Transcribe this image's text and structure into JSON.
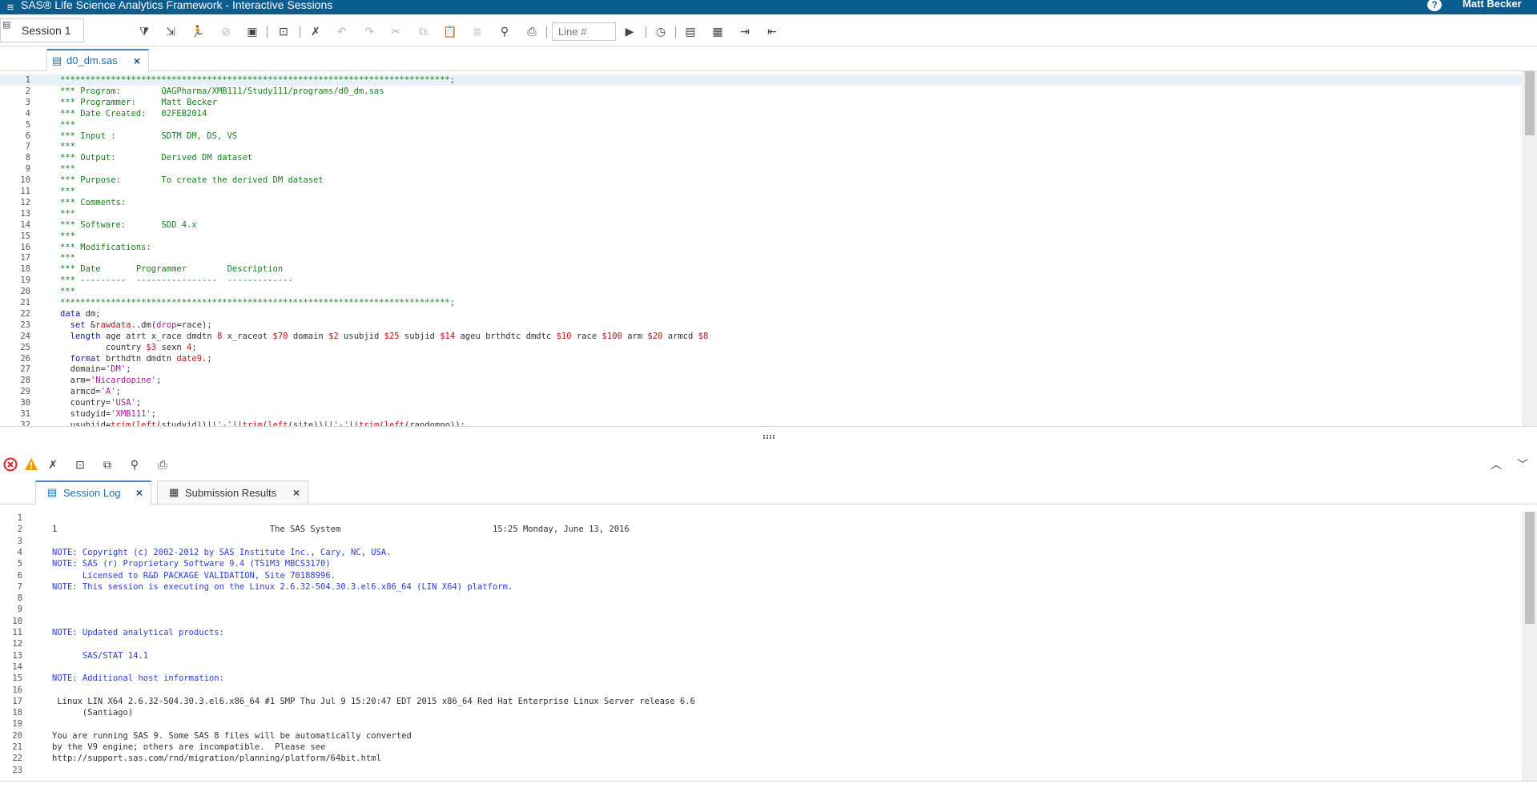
{
  "app": {
    "title": "SAS® Life Science Analytics Framework - Interactive Sessions",
    "user": "Matt Becker",
    "help_label": "?"
  },
  "toolbar": {
    "session_label": "Session 1",
    "line_placeholder": "Line #"
  },
  "editor_tab": {
    "label": "d0_dm.sas"
  },
  "editor": {
    "lines": [
      {
        "n": "1",
        "segs": [
          {
            "c": "cm",
            "t": "*****************************************************************************;"
          }
        ]
      },
      {
        "n": "2",
        "segs": [
          {
            "c": "cm",
            "t": "*** Program:        QAGPharma/XMB111/Study111/programs/d0_dm.sas"
          }
        ]
      },
      {
        "n": "3",
        "segs": [
          {
            "c": "cm",
            "t": "*** Programmer:     Matt Becker"
          }
        ]
      },
      {
        "n": "4",
        "segs": [
          {
            "c": "cm",
            "t": "*** Date Created:   02FEB2014"
          }
        ]
      },
      {
        "n": "5",
        "segs": [
          {
            "c": "cm",
            "t": "***"
          }
        ]
      },
      {
        "n": "6",
        "segs": [
          {
            "c": "cm",
            "t": "*** Input :         SDTM DM, DS, VS"
          }
        ]
      },
      {
        "n": "7",
        "segs": [
          {
            "c": "cm",
            "t": "***"
          }
        ]
      },
      {
        "n": "8",
        "segs": [
          {
            "c": "cm",
            "t": "*** Output:         Derived DM dataset"
          }
        ]
      },
      {
        "n": "9",
        "segs": [
          {
            "c": "cm",
            "t": "***"
          }
        ]
      },
      {
        "n": "10",
        "segs": [
          {
            "c": "cm",
            "t": "*** Purpose:        To create the derived DM dataset"
          }
        ]
      },
      {
        "n": "11",
        "segs": [
          {
            "c": "cm",
            "t": "***"
          }
        ]
      },
      {
        "n": "12",
        "segs": [
          {
            "c": "cm",
            "t": "*** Comments:"
          }
        ]
      },
      {
        "n": "13",
        "segs": [
          {
            "c": "cm",
            "t": "***"
          }
        ]
      },
      {
        "n": "14",
        "segs": [
          {
            "c": "cm",
            "t": "*** Software:       SDD 4.x"
          }
        ]
      },
      {
        "n": "15",
        "segs": [
          {
            "c": "cm",
            "t": "***"
          }
        ]
      },
      {
        "n": "16",
        "segs": [
          {
            "c": "cm",
            "t": "*** Modifications:"
          }
        ]
      },
      {
        "n": "17",
        "segs": [
          {
            "c": "cm",
            "t": "***"
          }
        ]
      },
      {
        "n": "18",
        "segs": [
          {
            "c": "cm",
            "t": "*** Date       Programmer        Description"
          }
        ]
      },
      {
        "n": "19",
        "segs": [
          {
            "c": "cm",
            "t": "*** ---------  ----------------  -------------"
          }
        ]
      },
      {
        "n": "20",
        "segs": [
          {
            "c": "cm",
            "t": "***"
          }
        ]
      },
      {
        "n": "21",
        "segs": [
          {
            "c": "cm",
            "t": "*****************************************************************************;"
          }
        ]
      },
      {
        "n": "22",
        "segs": [
          {
            "c": "kw",
            "t": "data"
          },
          {
            "c": "plain",
            "t": " dm;"
          }
        ]
      },
      {
        "n": "23",
        "segs": [
          {
            "c": "kw",
            "t": "  set"
          },
          {
            "c": "plain",
            "t": " &"
          },
          {
            "c": "fn",
            "t": "rawdata"
          },
          {
            "c": "plain",
            "t": "..dm("
          },
          {
            "c": "str",
            "t": "drop"
          },
          {
            "c": "plain",
            "t": "=race);"
          }
        ]
      },
      {
        "n": "24",
        "segs": [
          {
            "c": "kw",
            "t": "  length"
          },
          {
            "c": "plain",
            "t": " age atrt x_race dmdtn "
          },
          {
            "c": "num",
            "t": "8"
          },
          {
            "c": "plain",
            "t": " x_raceot "
          },
          {
            "c": "num",
            "t": "$70"
          },
          {
            "c": "plain",
            "t": " domain "
          },
          {
            "c": "num",
            "t": "$2"
          },
          {
            "c": "plain",
            "t": " usubjid "
          },
          {
            "c": "num",
            "t": "$25"
          },
          {
            "c": "plain",
            "t": " subjid "
          },
          {
            "c": "num",
            "t": "$14"
          },
          {
            "c": "plain",
            "t": " ageu brthdtc dmdtc "
          },
          {
            "c": "num",
            "t": "$10"
          },
          {
            "c": "plain",
            "t": " race "
          },
          {
            "c": "num",
            "t": "$100"
          },
          {
            "c": "plain",
            "t": " arm "
          },
          {
            "c": "num",
            "t": "$20"
          },
          {
            "c": "plain",
            "t": " armcd "
          },
          {
            "c": "num",
            "t": "$8"
          }
        ]
      },
      {
        "n": "25",
        "segs": [
          {
            "c": "plain",
            "t": "         country "
          },
          {
            "c": "num",
            "t": "$3"
          },
          {
            "c": "plain",
            "t": " sexn "
          },
          {
            "c": "num",
            "t": "4"
          },
          {
            "c": "plain",
            "t": ";"
          }
        ]
      },
      {
        "n": "26",
        "segs": [
          {
            "c": "kw",
            "t": "  format"
          },
          {
            "c": "plain",
            "t": " brthdtn dmdtn "
          },
          {
            "c": "fn",
            "t": "date9."
          },
          {
            "c": "plain",
            "t": ";"
          }
        ]
      },
      {
        "n": "27",
        "segs": [
          {
            "c": "plain",
            "t": "  domain="
          },
          {
            "c": "str",
            "t": "'DM'"
          },
          {
            "c": "plain",
            "t": ";"
          }
        ]
      },
      {
        "n": "28",
        "segs": [
          {
            "c": "plain",
            "t": "  arm="
          },
          {
            "c": "str",
            "t": "'Nicardopine'"
          },
          {
            "c": "plain",
            "t": ";"
          }
        ]
      },
      {
        "n": "29",
        "segs": [
          {
            "c": "plain",
            "t": "  armcd="
          },
          {
            "c": "str",
            "t": "'A'"
          },
          {
            "c": "plain",
            "t": ";"
          }
        ]
      },
      {
        "n": "30",
        "segs": [
          {
            "c": "plain",
            "t": "  country="
          },
          {
            "c": "str",
            "t": "'USA'"
          },
          {
            "c": "plain",
            "t": ";"
          }
        ]
      },
      {
        "n": "31",
        "segs": [
          {
            "c": "plain",
            "t": "  studyid="
          },
          {
            "c": "str",
            "t": "'XMB111'"
          },
          {
            "c": "plain",
            "t": ";"
          }
        ]
      },
      {
        "n": "32",
        "segs": [
          {
            "c": "plain",
            "t": "  usubjid="
          },
          {
            "c": "fn",
            "t": "trim"
          },
          {
            "c": "plain",
            "t": "("
          },
          {
            "c": "fn",
            "t": "left"
          },
          {
            "c": "plain",
            "t": "(studyid))||"
          },
          {
            "c": "str",
            "t": "'-'"
          },
          {
            "c": "plain",
            "t": "||"
          },
          {
            "c": "fn",
            "t": "trim"
          },
          {
            "c": "plain",
            "t": "("
          },
          {
            "c": "fn",
            "t": "left"
          },
          {
            "c": "plain",
            "t": "(site))||"
          },
          {
            "c": "str",
            "t": "'-'"
          },
          {
            "c": "plain",
            "t": "||"
          },
          {
            "c": "fn",
            "t": "trim"
          },
          {
            "c": "plain",
            "t": "("
          },
          {
            "c": "fn",
            "t": "left"
          },
          {
            "c": "plain",
            "t": "(randomno));"
          }
        ]
      }
    ]
  },
  "log_tabs": [
    {
      "label": "Session Log"
    },
    {
      "label": "Submission Results"
    }
  ],
  "log": {
    "lines": [
      {
        "n": "1",
        "c": "plain",
        "t": ""
      },
      {
        "n": "2",
        "c": "plain",
        "t": "1                                          The SAS System                              15:25 Monday, June 13, 2016"
      },
      {
        "n": "3",
        "c": "plain",
        "t": ""
      },
      {
        "n": "4",
        "c": "note",
        "t": "NOTE: Copyright (c) 2002-2012 by SAS Institute Inc., Cary, NC, USA."
      },
      {
        "n": "5",
        "c": "note",
        "t": "NOTE: SAS (r) Proprietary Software 9.4 (TS1M3 MBCS3170)"
      },
      {
        "n": "6",
        "c": "note",
        "t": "      Licensed to R&D PACKAGE VALIDATION, Site 70188996."
      },
      {
        "n": "7",
        "c": "note",
        "t": "NOTE: This session is executing on the Linux 2.6.32-504.30.3.el6.x86_64 (LIN X64) platform."
      },
      {
        "n": "8",
        "c": "plain",
        "t": ""
      },
      {
        "n": "9",
        "c": "plain",
        "t": ""
      },
      {
        "n": "10",
        "c": "plain",
        "t": ""
      },
      {
        "n": "11",
        "c": "note",
        "t": "NOTE: Updated analytical products:"
      },
      {
        "n": "12",
        "c": "plain",
        "t": ""
      },
      {
        "n": "13",
        "c": "note",
        "t": "      SAS/STAT 14.1"
      },
      {
        "n": "14",
        "c": "plain",
        "t": ""
      },
      {
        "n": "15",
        "c": "note",
        "t": "NOTE: Additional host information:"
      },
      {
        "n": "16",
        "c": "plain",
        "t": ""
      },
      {
        "n": "17",
        "c": "plain",
        "t": " Linux LIN X64 2.6.32-504.30.3.el6.x86_64 #1 SMP Thu Jul 9 15:20:47 EDT 2015 x86_64 Red Hat Enterprise Linux Server release 6.6"
      },
      {
        "n": "18",
        "c": "plain",
        "t": "      (Santiago)"
      },
      {
        "n": "19",
        "c": "plain",
        "t": ""
      },
      {
        "n": "20",
        "c": "plain",
        "t": "You are running SAS 9. Some SAS 8 files will be automatically converted"
      },
      {
        "n": "21",
        "c": "plain",
        "t": "by the V9 engine; others are incompatible.  Please see"
      },
      {
        "n": "22",
        "c": "plain",
        "t": "http://support.sas.com/rnd/migration/planning/platform/64bit.html"
      },
      {
        "n": "23",
        "c": "plain",
        "t": ""
      }
    ]
  },
  "colors": {
    "title_bar": "#0b5d8f",
    "accent": "#3f86c5",
    "comment": "#187e1e",
    "keyword": "#1a1ab4",
    "string": "#b0189c",
    "number": "#c41313",
    "note": "#2c3ed8",
    "error": "#e0202a",
    "warning": "#e8a100"
  },
  "icons": {
    "toolbar": [
      "filter-icon",
      "export-icon",
      "run-icon",
      "cancel-icon",
      "save-icon",
      "save-as-icon",
      "clear-icon",
      "undo-icon",
      "redo-icon",
      "cut-icon",
      "copy-icon",
      "paste-icon",
      "format-icon",
      "find-icon",
      "print-icon",
      "go-icon",
      "history-icon",
      "notes-icon",
      "table-icon",
      "import-icon",
      "export-table-icon"
    ],
    "logbar": [
      "error-icon",
      "warning-icon",
      "clear-log-icon",
      "save-log-icon",
      "copy-log-icon",
      "find-log-icon",
      "print-log-icon",
      "expand-icon",
      "collapse-icon"
    ]
  }
}
